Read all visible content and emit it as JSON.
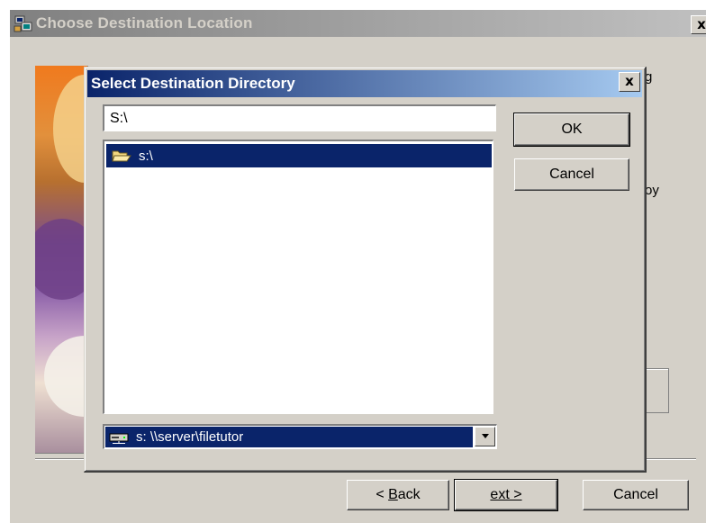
{
  "outer_window": {
    "title": "Choose Destination Location",
    "close_label": "x",
    "frag_top": "g",
    "frag_mid": "oy",
    "buttons": {
      "back": "< Back",
      "next": "Next >",
      "cancel": "Cancel"
    }
  },
  "dialog": {
    "title": "Select Destination Directory",
    "close_label": "x",
    "path_value": "S:\\",
    "directory_items": [
      {
        "label": "s:\\",
        "icon": "open-folder-icon",
        "selected": true
      }
    ],
    "drive": {
      "selected": "s:  \\\\server\\filetutor",
      "icon": "network-drive-icon"
    },
    "ok_label": "OK",
    "cancel_label": "Cancel"
  },
  "colors": {
    "face": "#d4d0c8",
    "active_title": "#0a246a",
    "selection": "#0a246a",
    "inactive_title": "#808080"
  }
}
